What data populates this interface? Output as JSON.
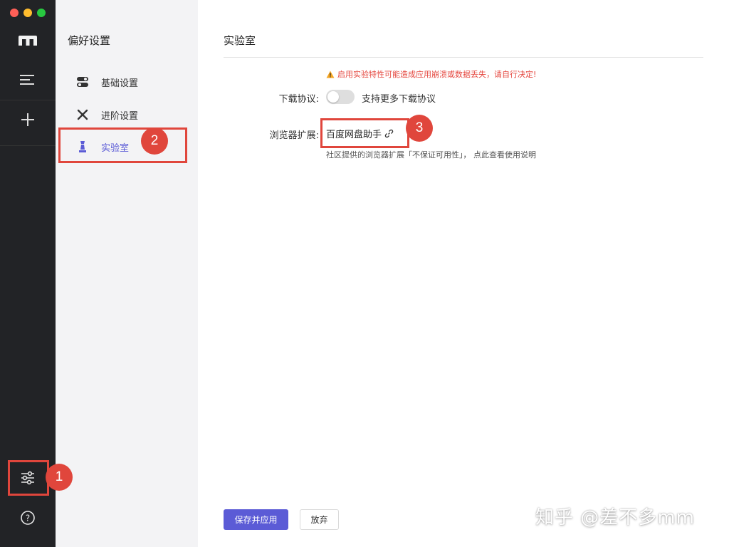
{
  "rail": {
    "logo": "logo-icon",
    "menu": "menu-icon",
    "add": "plus-icon",
    "settings": "sliders-icon",
    "help": "help-icon"
  },
  "sidebar": {
    "title": "偏好设置",
    "items": [
      {
        "label": "基础设置",
        "icon": "toggle-icon"
      },
      {
        "label": "进阶设置",
        "icon": "tools-icon"
      },
      {
        "label": "实验室",
        "icon": "chess-pawn-icon",
        "active": true
      }
    ]
  },
  "main": {
    "title": "实验室",
    "warning": "启用实验特性可能造成应用崩溃或数据丢失，请自行决定!",
    "download_label": "下载协议:",
    "download_toggle_text": "支持更多下载协议",
    "download_toggle_on": false,
    "extension_label": "浏览器扩展:",
    "extension_link": "百度网盘助手",
    "extension_note": "社区提供的浏览器扩展「不保证可用性」， 点此查看使用说明",
    "save_button": "保存并应用",
    "discard_button": "放弃"
  },
  "annotations": {
    "badge1": "1",
    "badge2": "2",
    "badge3": "3"
  },
  "watermark": "知乎 @差不多mm",
  "colors": {
    "accent": "#5b5bd6",
    "warning": "#e5473f",
    "annotation": "#e0463c",
    "rail_bg": "#222326",
    "sidebar_bg": "#f3f3f5"
  }
}
